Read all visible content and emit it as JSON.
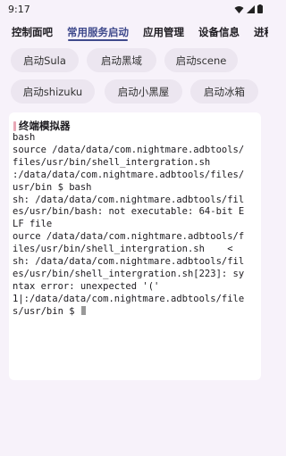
{
  "status_bar": {
    "time": "9:17",
    "icons": [
      "wifi-icon",
      "signal-icon",
      "battery-icon"
    ]
  },
  "tabs": [
    {
      "label": "控制面吧",
      "active": false
    },
    {
      "label": "常用服务启动",
      "active": true
    },
    {
      "label": "应用管理",
      "active": false
    },
    {
      "label": "设备信息",
      "active": false
    },
    {
      "label": "进程",
      "active": false
    }
  ],
  "buttons": {
    "row1": [
      "启动Sula",
      "启动黑域",
      "启动scene"
    ],
    "row2": [
      "启动shizuku",
      "启动小黑屋",
      "启动冰箱"
    ]
  },
  "terminal": {
    "title": "终端模拟器",
    "lines": [
      "bash",
      "source /data/data/com.nightmare.adbtools/",
      "files/usr/bin/shell_intergration.sh",
      ":/data/data/com.nightmare.adbtools/files/",
      "usr/bin $ bash",
      "sh: /data/data/com.nightmare.adbtools/fil",
      "es/usr/bin/bash: not executable: 64-bit E",
      "LF file",
      "ource /data/data/com.nightmare.adbtools/f",
      "iles/usr/bin/shell_intergration.sh    <",
      "sh: /data/data/com.nightmare.adbtools/fil",
      "es/usr/bin/shell_intergration.sh[223]: sy",
      "ntax error: unexpected '('",
      "1|:/data/data/com.nightmare.adbtools/file",
      "s/usr/bin $ "
    ]
  },
  "colors": {
    "background": "#f7f2fa",
    "accent": "#3f4a8c",
    "chip": "#ece6f0",
    "card": "#ffffff"
  }
}
